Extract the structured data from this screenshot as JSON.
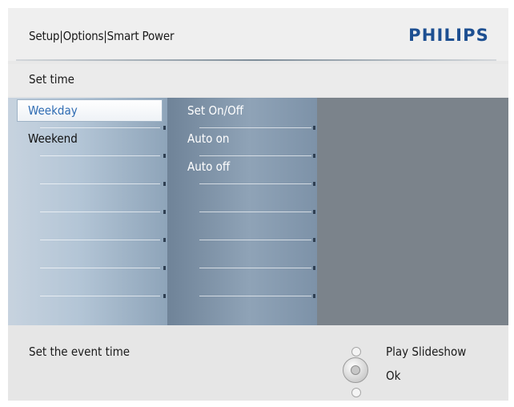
{
  "header": {
    "breadcrumb": "Setup|Options|Smart Power",
    "logo_text": "PHILIPS"
  },
  "subtitle": "Set time",
  "menu": {
    "items": [
      {
        "label": "Weekday",
        "selected": true
      },
      {
        "label": "Weekend",
        "selected": false
      }
    ]
  },
  "submenu": {
    "items": [
      {
        "label": "Set On/Off"
      },
      {
        "label": "Auto on"
      },
      {
        "label": "Auto off"
      }
    ]
  },
  "footer": {
    "hint": "Set the event time",
    "actions": [
      {
        "label": "Play Slideshow"
      },
      {
        "label": "Ok"
      }
    ]
  },
  "colors": {
    "logo": "#1d4f91",
    "selected_text": "#2f6cb3",
    "menu_text": "#111111",
    "submenu_text": "#ffffff"
  }
}
